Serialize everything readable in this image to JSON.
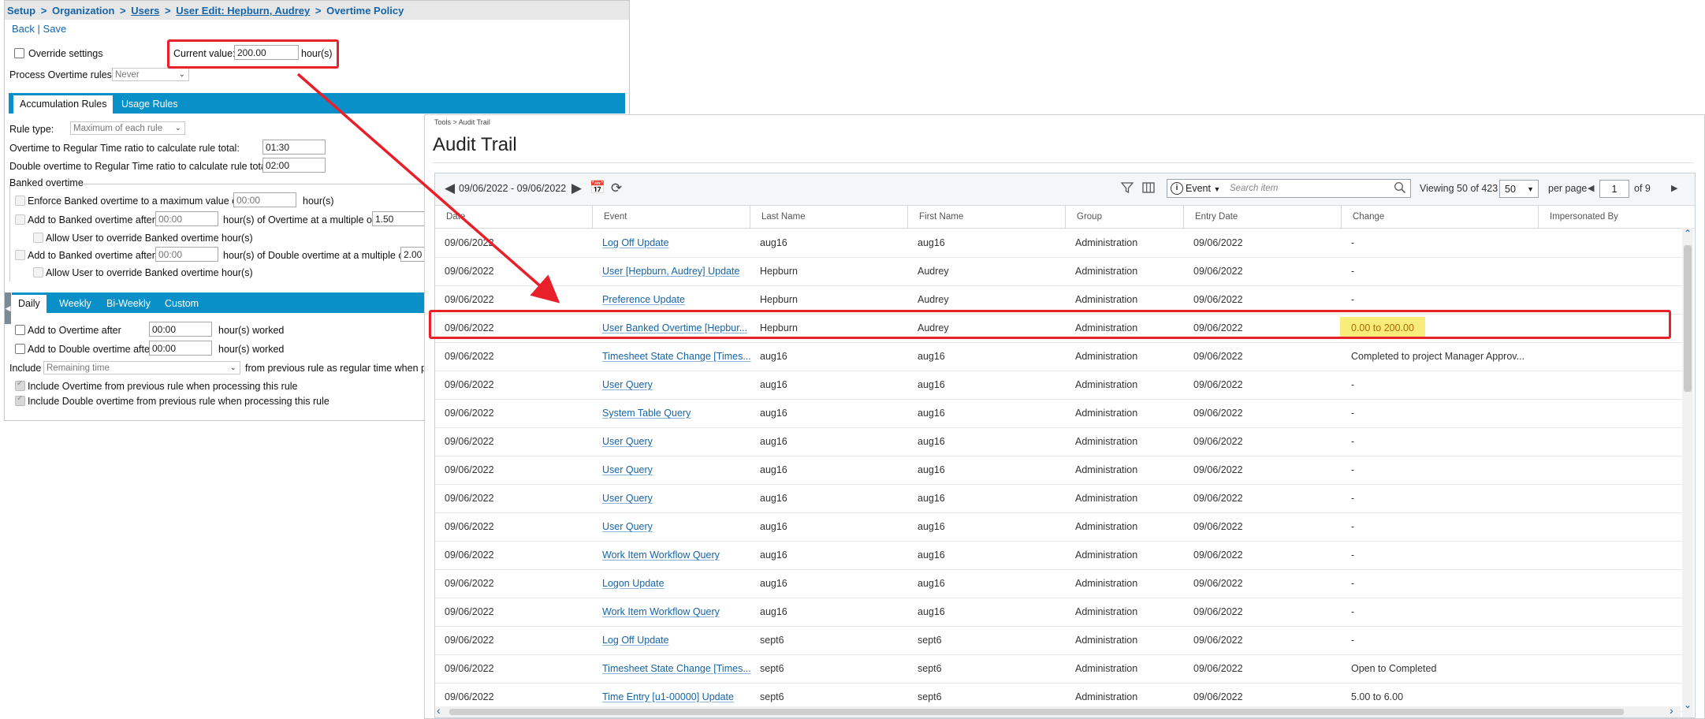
{
  "policy": {
    "breadcrumb": [
      "Setup",
      "Organization",
      "Users",
      "User Edit: Hepburn, Audrey",
      "Overtime Policy"
    ],
    "breadcrumb_sep": ">",
    "back": "Back",
    "save": "Save",
    "link_sep": "|",
    "override_label": "Override settings",
    "current_value_label": "Current value:",
    "current_value": "200.00",
    "hours_unit": "hour(s)",
    "process_rules_label": "Process Overtime rules:",
    "process_rules_value": "Never",
    "tabs_top": [
      "Accumulation Rules",
      "Usage Rules"
    ],
    "rule_type_label": "Rule type:",
    "rule_type_value": "Maximum of each rule",
    "ot_ratio_label": "Overtime to Regular Time ratio to calculate rule total:",
    "ot_ratio_value": "01:30",
    "dot_ratio_label": "Double overtime to Regular Time ratio to calculate rule total:",
    "dot_ratio_value": "02:00",
    "banked_title": "Banked overtime",
    "enforce_label": "Enforce Banked overtime to a maximum value of",
    "enforce_value": "00:00",
    "enforce_unit": "hour(s)",
    "add_banked_label": "Add to Banked overtime after",
    "add_banked_value": "00:00",
    "add_banked_mid": "hour(s) of Overtime at a multiple of",
    "add_banked_mult": "1.50",
    "allow_override_label": "Allow User to override Banked overtime hour(s)",
    "add_banked_d_label": "Add to Banked overtime after",
    "add_banked_d_value": "00:00",
    "add_banked_d_mid": "hour(s) of Double overtime at a multiple of",
    "add_banked_d_mult": "2.00",
    "allow_override_label2": "Allow User to override Banked overtime hour(s)",
    "tabs_period": [
      "Daily",
      "Weekly",
      "Bi-Weekly",
      "Custom"
    ],
    "add_ot_label": "Add to Overtime after",
    "add_ot_value": "00:00",
    "add_ot_unit": "hour(s) worked",
    "add_dot_label": "Add to Double overtime after",
    "add_dot_value": "00:00",
    "add_dot_unit": "hour(s) worked",
    "include_label": "Include",
    "include_value": "Remaining time",
    "include_suffix": "from previous rule as regular time when pro",
    "include_ot_label": "Include Overtime from previous rule when processing this rule",
    "include_dot_label": "Include Double overtime from previous rule when processing this rule"
  },
  "audit": {
    "crumb": "Tools > Audit Trail",
    "title": "Audit Trail",
    "date_range": "09/06/2022 - 09/06/2022",
    "event_filter": "Event",
    "search_placeholder": "Search item",
    "viewing_label": "Viewing",
    "viewing_count": "50",
    "of_label": "of",
    "total": "423",
    "per_page_value": "50",
    "per_page_label": "per page",
    "page": "1",
    "page_total_label": "of 9",
    "columns": [
      "Date",
      "Event",
      "Last Name",
      "First Name",
      "Group",
      "Entry Date",
      "Change",
      "Impersonated By"
    ],
    "rows": [
      {
        "date": "09/06/2022",
        "event": "Log Off Update",
        "last": "aug16",
        "first": "aug16",
        "group": "Administration",
        "entry": "09/06/2022",
        "change": "-"
      },
      {
        "date": "09/06/2022",
        "event": "User [Hepburn, Audrey] Update",
        "last": "Hepburn",
        "first": "Audrey",
        "group": "Administration",
        "entry": "09/06/2022",
        "change": "-"
      },
      {
        "date": "09/06/2022",
        "event": "Preference Update",
        "last": "Hepburn",
        "first": "Audrey",
        "group": "Administration",
        "entry": "09/06/2022",
        "change": "-"
      },
      {
        "date": "09/06/2022",
        "event": "User Banked Overtime [Hepbur...",
        "last": "Hepburn",
        "first": "Audrey",
        "group": "Administration",
        "entry": "09/06/2022",
        "change": "0.00 to 200.00"
      },
      {
        "date": "09/06/2022",
        "event": "Timesheet State Change [Times...",
        "last": "aug16",
        "first": "aug16",
        "group": "Administration",
        "entry": "09/06/2022",
        "change": "Completed to project Manager Approv..."
      },
      {
        "date": "09/06/2022",
        "event": "User Query",
        "last": "aug16",
        "first": "aug16",
        "group": "Administration",
        "entry": "09/06/2022",
        "change": "-"
      },
      {
        "date": "09/06/2022",
        "event": "System Table Query",
        "last": "aug16",
        "first": "aug16",
        "group": "Administration",
        "entry": "09/06/2022",
        "change": "-"
      },
      {
        "date": "09/06/2022",
        "event": "User Query",
        "last": "aug16",
        "first": "aug16",
        "group": "Administration",
        "entry": "09/06/2022",
        "change": "-"
      },
      {
        "date": "09/06/2022",
        "event": "User Query",
        "last": "aug16",
        "first": "aug16",
        "group": "Administration",
        "entry": "09/06/2022",
        "change": "-"
      },
      {
        "date": "09/06/2022",
        "event": "User Query",
        "last": "aug16",
        "first": "aug16",
        "group": "Administration",
        "entry": "09/06/2022",
        "change": "-"
      },
      {
        "date": "09/06/2022",
        "event": "User Query",
        "last": "aug16",
        "first": "aug16",
        "group": "Administration",
        "entry": "09/06/2022",
        "change": "-"
      },
      {
        "date": "09/06/2022",
        "event": "Work Item Workflow Query",
        "last": "aug16",
        "first": "aug16",
        "group": "Administration",
        "entry": "09/06/2022",
        "change": "-"
      },
      {
        "date": "09/06/2022",
        "event": "Logon Update",
        "last": "aug16",
        "first": "aug16",
        "group": "Administration",
        "entry": "09/06/2022",
        "change": "-"
      },
      {
        "date": "09/06/2022",
        "event": "Work Item Workflow Query",
        "last": "aug16",
        "first": "aug16",
        "group": "Administration",
        "entry": "09/06/2022",
        "change": "-"
      },
      {
        "date": "09/06/2022",
        "event": "Log Off Update",
        "last": "sept6",
        "first": "sept6",
        "group": "Administration",
        "entry": "09/06/2022",
        "change": "-"
      },
      {
        "date": "09/06/2022",
        "event": "Timesheet State Change [Times...",
        "last": "sept6",
        "first": "sept6",
        "group": "Administration",
        "entry": "09/06/2022",
        "change": "Open to Completed"
      },
      {
        "date": "09/06/2022",
        "event": "Time Entry [u1-00000] Update",
        "last": "sept6",
        "first": "sept6",
        "group": "Administration",
        "entry": "09/06/2022",
        "change": "5.00 to 6.00"
      }
    ]
  },
  "colors": {
    "accent_tab": "#0a90c8",
    "link": "#1565a8",
    "highlight_red": "#e8202a",
    "change_highlight": "#f8ec7a"
  }
}
